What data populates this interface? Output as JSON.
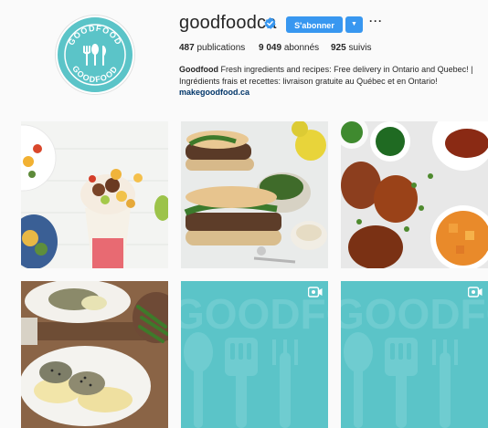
{
  "profile": {
    "avatar_text": "GOODFOOD",
    "username": "goodfoodca",
    "verified": true,
    "follow_label": "S'abonner",
    "dropdown_icon": "caret-down-icon",
    "more_icon": "more-horizontal-icon",
    "stats": {
      "publications_count": "487",
      "publications_label": "publications",
      "followers_count": "9 049",
      "followers_label": "abonnés",
      "following_count": "925",
      "following_label": "suivis"
    },
    "bio": {
      "name": "Goodfood",
      "text_line1": "Fresh ingredients and recipes: Free delivery in Ontario and Quebec! |",
      "text_line2": "Ingrédients frais et recettes: livraison gratuite au Québec et en Ontario!",
      "link": "makegoodfood.ca"
    }
  },
  "colors": {
    "brand_teal": "#5bc4c8",
    "follow_blue": "#3897f0",
    "link_blue": "#003569"
  },
  "posts": [
    {
      "type": "photo",
      "description_icon": "burrito-photo"
    },
    {
      "type": "photo",
      "description_icon": "steak-sandwich-photo"
    },
    {
      "type": "photo",
      "description_icon": "glazed-chicken-photo"
    },
    {
      "type": "photo",
      "description_icon": "sesame-pork-mash-photo"
    },
    {
      "type": "video",
      "description_icon": "goodfood-pattern-video",
      "badge_icon": "video-camera-icon"
    },
    {
      "type": "video",
      "description_icon": "goodfood-pattern-video",
      "badge_icon": "video-camera-icon"
    }
  ]
}
